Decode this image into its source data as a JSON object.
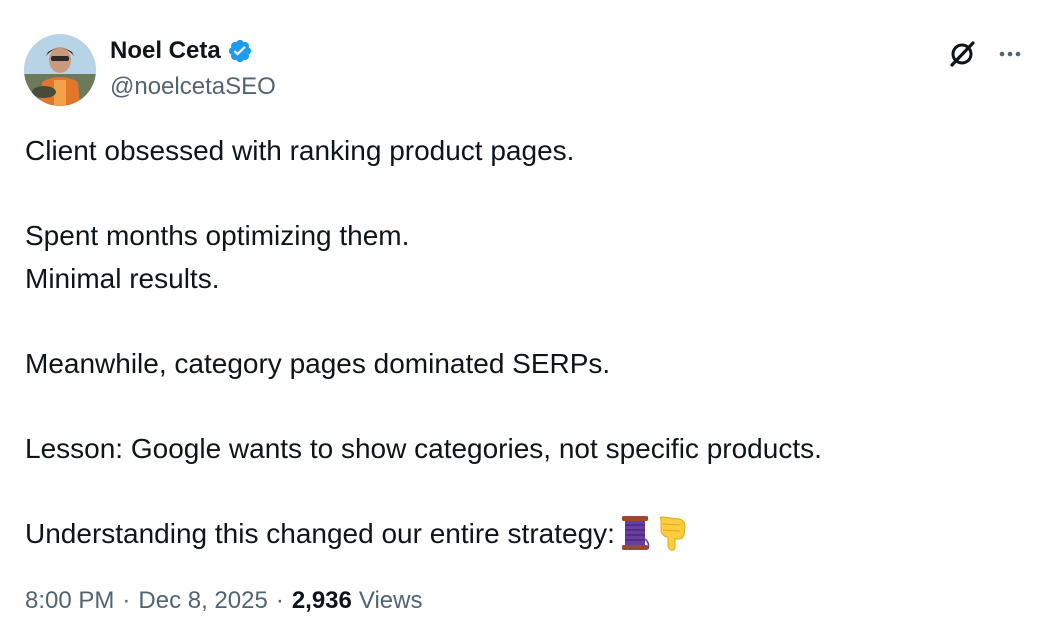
{
  "author": {
    "display_name": "Noel Ceta",
    "handle": "@noelcetaSEO",
    "verified": true,
    "verified_color": "#1d9bf0"
  },
  "actions": {
    "grok_icon": "grok-icon",
    "more_icon": "more-horizontal-icon"
  },
  "tweet": {
    "paragraphs": [
      [
        "Client obsessed with ranking product pages."
      ],
      [
        "Spent months optimizing them.",
        "Minimal results."
      ],
      [
        "Meanwhile, category pages dominated SERPs."
      ],
      [
        "Lesson: Google wants to show categories, not specific products."
      ],
      [
        "Understanding this changed our entire strategy:"
      ]
    ],
    "trailing_emojis": [
      "thread-spool-emoji",
      "pointing-down-emoji"
    ]
  },
  "meta": {
    "time": "8:00 PM",
    "separator": "·",
    "date": "Dec 8, 2025",
    "views_count": "2,936",
    "views_label": "Views"
  },
  "colors": {
    "text_primary": "#0f1419",
    "text_secondary": "#536471",
    "accent": "#1d9bf0"
  }
}
